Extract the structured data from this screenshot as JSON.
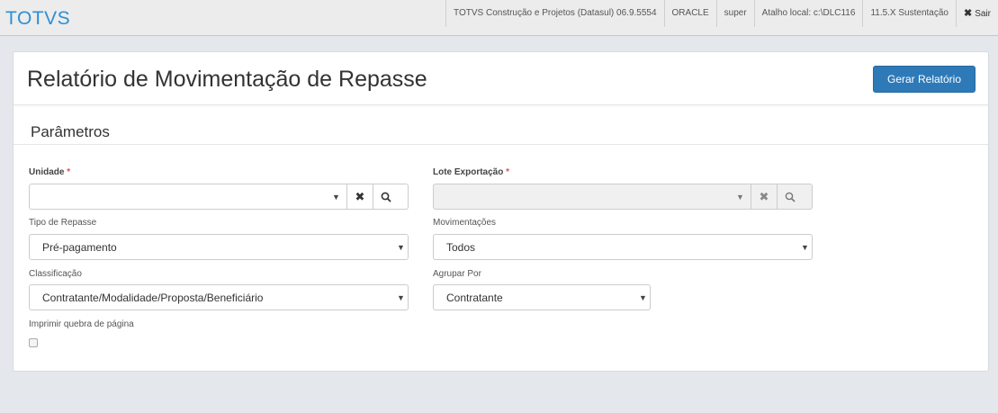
{
  "header": {
    "brand": "TOTVS",
    "product": "TOTVS Construção e Projetos (Datasul) 06.9.5554",
    "database": "ORACLE",
    "user": "super",
    "shortcut": "Atalho local: c:\\DLC116",
    "version": "11.5.X Sustentação",
    "exit_label": "Sair"
  },
  "page": {
    "title": "Relatório de Movimentação de Repasse",
    "generate_button": "Gerar Relatório",
    "section_title": "Parâmetros"
  },
  "form": {
    "unidade": {
      "label": "Unidade",
      "required_mark": "*",
      "value": ""
    },
    "lote": {
      "label": "Lote Exportação",
      "required_mark": "*",
      "value": ""
    },
    "tipo_repasse": {
      "label": "Tipo de Repasse",
      "value": "Pré-pagamento"
    },
    "movimentacoes": {
      "label": "Movimentações",
      "value": "Todos"
    },
    "classificacao": {
      "label": "Classificação",
      "value": "Contratante/Modalidade/Proposta/Beneficiário"
    },
    "agrupar": {
      "label": "Agrupar Por",
      "value": "Contratante"
    },
    "quebra": {
      "label": "Imprimir quebra de página",
      "checked": false
    }
  },
  "icons": {
    "dropdown": "caret-down-icon",
    "clear": "times-icon",
    "search": "search-icon",
    "exit": "times-icon"
  },
  "colors": {
    "brand": "#2d8fd4",
    "primary_button": "#2e7ab8",
    "required": "#d9534f",
    "background": "#e4e8ec"
  }
}
